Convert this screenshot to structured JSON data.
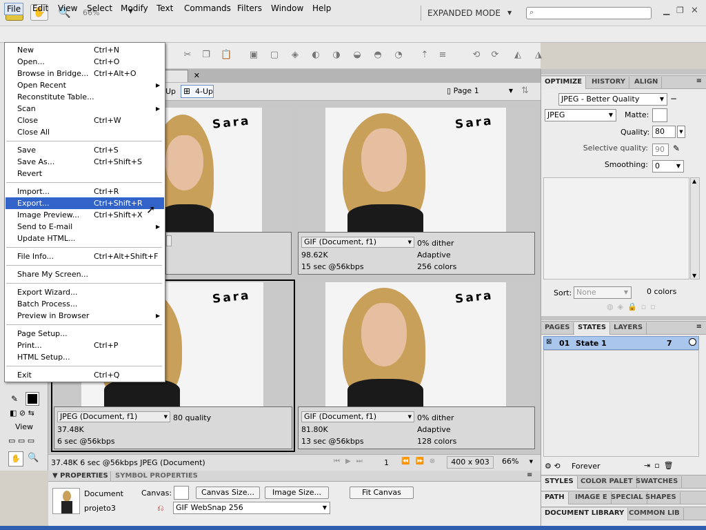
{
  "app": {
    "logo": "Fw",
    "zoom": "66%",
    "mode": "EXPANDED MODE"
  },
  "menubar": [
    "File",
    "Edit",
    "View",
    "Select",
    "Modify",
    "Text",
    "Commands",
    "Filters",
    "Window",
    "Help"
  ],
  "file_menu": {
    "groups": [
      [
        {
          "label": "New",
          "shortcut": "Ctrl+N"
        },
        {
          "label": "Open...",
          "shortcut": "Ctrl+O"
        },
        {
          "label": "Browse in Bridge...",
          "shortcut": "Ctrl+Alt+O"
        },
        {
          "label": "Open Recent",
          "shortcut": "",
          "submenu": true
        },
        {
          "label": "Reconstitute Table...",
          "shortcut": ""
        },
        {
          "label": "Scan",
          "shortcut": "",
          "submenu": true
        },
        {
          "label": "Close",
          "shortcut": "Ctrl+W"
        },
        {
          "label": "Close All",
          "shortcut": ""
        }
      ],
      [
        {
          "label": "Save",
          "shortcut": "Ctrl+S"
        },
        {
          "label": "Save As...",
          "shortcut": "Ctrl+Shift+S"
        },
        {
          "label": "Revert",
          "shortcut": ""
        }
      ],
      [
        {
          "label": "Import...",
          "shortcut": "Ctrl+R"
        },
        {
          "label": "Export...",
          "shortcut": "Ctrl+Shift+R",
          "highlighted": true
        },
        {
          "label": "Image Preview...",
          "shortcut": "Ctrl+Shift+X"
        },
        {
          "label": "Send to E-mail",
          "shortcut": "",
          "submenu": true
        },
        {
          "label": "Update HTML...",
          "shortcut": ""
        }
      ],
      [
        {
          "label": "File Info...",
          "shortcut": "Ctrl+Alt+Shift+F"
        }
      ],
      [
        {
          "label": "Share My Screen...",
          "shortcut": ""
        }
      ],
      [
        {
          "label": "Export Wizard...",
          "shortcut": ""
        },
        {
          "label": "Batch Process...",
          "shortcut": ""
        },
        {
          "label": "Preview in Browser",
          "shortcut": "",
          "submenu": true
        }
      ],
      [
        {
          "label": "Page Setup...",
          "shortcut": ""
        },
        {
          "label": "Print...",
          "shortcut": "Ctrl+P"
        },
        {
          "label": "HTML Setup...",
          "shortcut": ""
        }
      ],
      [
        {
          "label": "Exit",
          "shortcut": "Ctrl+Q"
        }
      ]
    ]
  },
  "document": {
    "tab_label": "*",
    "view_up": "Up",
    "view_4up": "4-Up",
    "page": "Page 1",
    "image_text": "Sara",
    "panes": [
      {
        "format": "",
        "line2": "",
        "line3": "",
        "right1": "",
        "right2": "",
        "right3": ""
      },
      {
        "format": "GIF (Document, f1)",
        "line2": "98.62K",
        "line3": "15 sec @56kbps",
        "right1": "0% dither",
        "right2": "Adaptive",
        "right3": "256 colors"
      },
      {
        "format": "JPEG (Document, f1)",
        "line2": "37.48K",
        "line3": "6 sec @56kbps",
        "right1": "80 quality",
        "right2": "",
        "right3": ""
      },
      {
        "format": "GIF (Document, f1)",
        "line2": "81.80K",
        "line3": "13 sec @56kbps",
        "right1": "0% dither",
        "right2": "Adaptive",
        "right3": "128 colors"
      }
    ]
  },
  "tools": {
    "view_label": "View"
  },
  "statusbar": {
    "info": "37.48K  6 sec @56kbps  JPEG (Document)",
    "frame": "1",
    "size": "400 x 903",
    "zoom": "66%"
  },
  "properties": {
    "tabs": [
      "PROPERTIES",
      "SYMBOL PROPERTIES"
    ],
    "doc_label": "Document",
    "doc_name": "projeto3",
    "canvas_label": "Canvas:",
    "canvas_size": "Canvas Size...",
    "image_size": "Image Size...",
    "fit_canvas": "Fit Canvas",
    "palette": "GIF WebSnap 256"
  },
  "optimize": {
    "tabs": [
      "OPTIMIZE",
      "HISTORY",
      "ALIGN"
    ],
    "preset": "JPEG - Better Quality",
    "format": "JPEG",
    "matte_label": "Matte:",
    "quality_label": "Quality:",
    "quality": "80",
    "selective_label": "Selective quality:",
    "selective": "90",
    "smoothing_label": "Smoothing:",
    "smoothing": "0",
    "sort_label": "Sort:",
    "sort": "None",
    "colors": "0 colors"
  },
  "states": {
    "tabs": [
      "PAGES",
      "STATES",
      "LAYERS"
    ],
    "row_num": "01",
    "row_name": "State 1",
    "row_delay": "7",
    "forever": "Forever"
  },
  "bottom_tabs": {
    "row1": [
      "STYLES",
      "COLOR PALET",
      "SWATCHES"
    ],
    "row2": [
      "PATH",
      "IMAGE E",
      "SPECIAL",
      "SHAPES"
    ],
    "row3": [
      "DOCUMENT LIBRARY",
      "COMMON LIB"
    ]
  }
}
